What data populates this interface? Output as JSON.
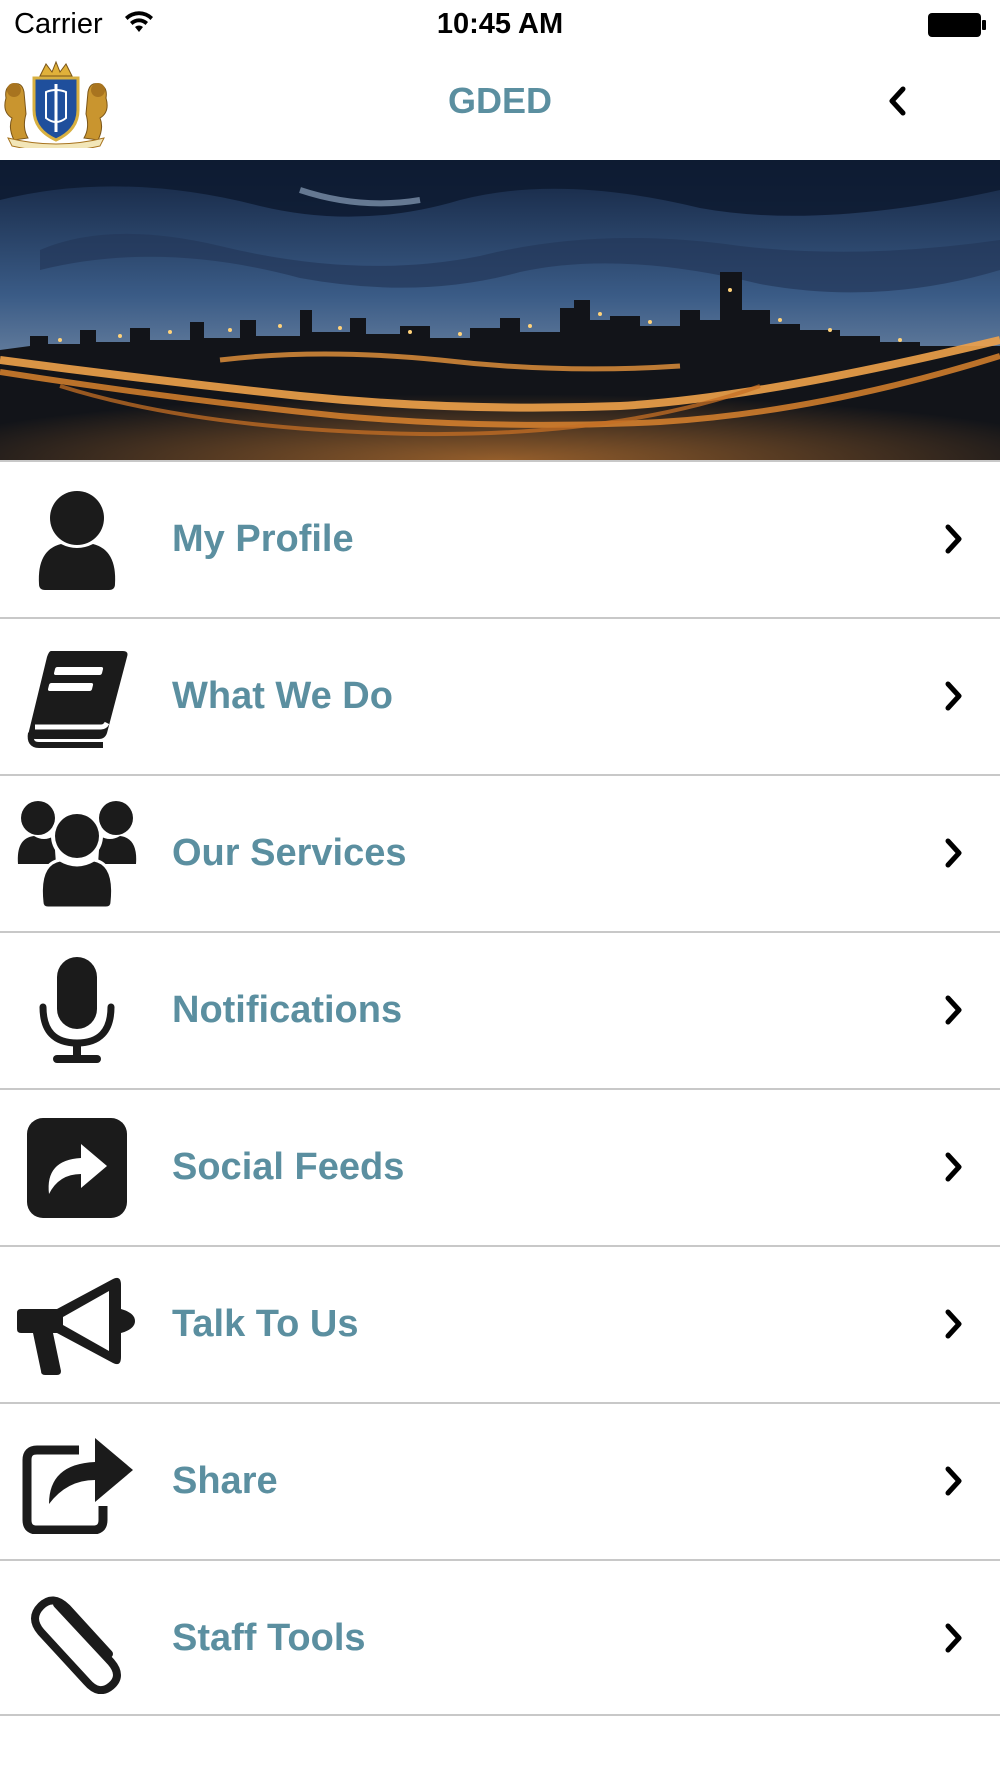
{
  "status_bar": {
    "carrier": "Carrier",
    "time": "10:45 AM"
  },
  "nav_bar": {
    "title": "GDED",
    "logo_icon": "coat-of-arms-logo",
    "back_icon": "chevron-left-icon"
  },
  "hero": {
    "image": "city-skyline-at-dusk"
  },
  "colors": {
    "accent": "#5b8fa0",
    "icon": "#1b1b1b",
    "divider": "#c8c8c8"
  },
  "menu": {
    "items": [
      {
        "label": "My Profile",
        "icon": "user-icon"
      },
      {
        "label": "What We Do",
        "icon": "book-icon"
      },
      {
        "label": "Our Services",
        "icon": "users-icon"
      },
      {
        "label": "Notifications",
        "icon": "microphone-icon"
      },
      {
        "label": "Social Feeds",
        "icon": "share-square-icon"
      },
      {
        "label": "Talk To Us",
        "icon": "megaphone-icon"
      },
      {
        "label": "Share",
        "icon": "share-arrow-icon"
      },
      {
        "label": "Staff Tools",
        "icon": "paperclip-icon"
      }
    ]
  }
}
